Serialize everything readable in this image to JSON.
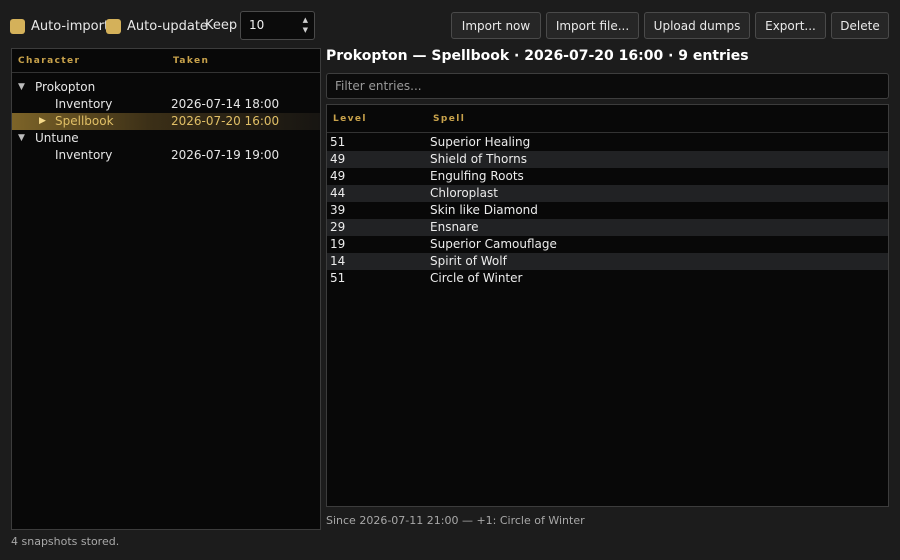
{
  "toolbar": {
    "auto_import": {
      "label": "Auto-import",
      "checked": true
    },
    "auto_update": {
      "label": "Auto-update",
      "checked": true
    },
    "keep_label": "Keep",
    "keep_value": "10",
    "buttons": {
      "import_now": "Import now",
      "import_file": "Import file...",
      "upload_dumps": "Upload dumps",
      "export": "Export...",
      "delete": "Delete"
    }
  },
  "tree": {
    "columns": {
      "character": "Character",
      "taken": "Taken"
    },
    "characters": [
      {
        "name": "Prokopton",
        "snapshots": [
          {
            "name": "Inventory",
            "taken": "2026-07-14 18:00",
            "selected": false
          },
          {
            "name": "Spellbook",
            "taken": "2026-07-20 16:00",
            "selected": true
          }
        ]
      },
      {
        "name": "Untune",
        "snapshots": [
          {
            "name": "Inventory",
            "taken": "2026-07-19 19:00",
            "selected": false
          }
        ]
      }
    ]
  },
  "detail": {
    "title": "Prokopton — Spellbook · 2026-07-20 16:00 · 9 entries",
    "filter_placeholder": "Filter entries...",
    "columns": {
      "level": "Level",
      "spell": "Spell"
    },
    "rows": [
      {
        "level": "51",
        "spell": "Superior Healing"
      },
      {
        "level": "49",
        "spell": "Shield of Thorns"
      },
      {
        "level": "49",
        "spell": "Engulfing Roots"
      },
      {
        "level": "44",
        "spell": "Chloroplast"
      },
      {
        "level": "39",
        "spell": "Skin like Diamond"
      },
      {
        "level": "29",
        "spell": "Ensnare"
      },
      {
        "level": "19",
        "spell": "Superior Camouflage"
      },
      {
        "level": "14",
        "spell": "Spirit of Wolf"
      },
      {
        "level": "51",
        "spell": "Circle of Winter"
      }
    ],
    "diff_status": "Since 2026-07-11 21:00 — +1: Circle of Winter"
  },
  "status": {
    "footer": "4 snapshots stored."
  },
  "icons": {
    "expanded": "triangle-down-icon",
    "collapsed": "triangle-right-icon"
  },
  "colors": {
    "accent": "#d4b15a",
    "header": "#c8a24b",
    "selection": "#7d6428"
  }
}
